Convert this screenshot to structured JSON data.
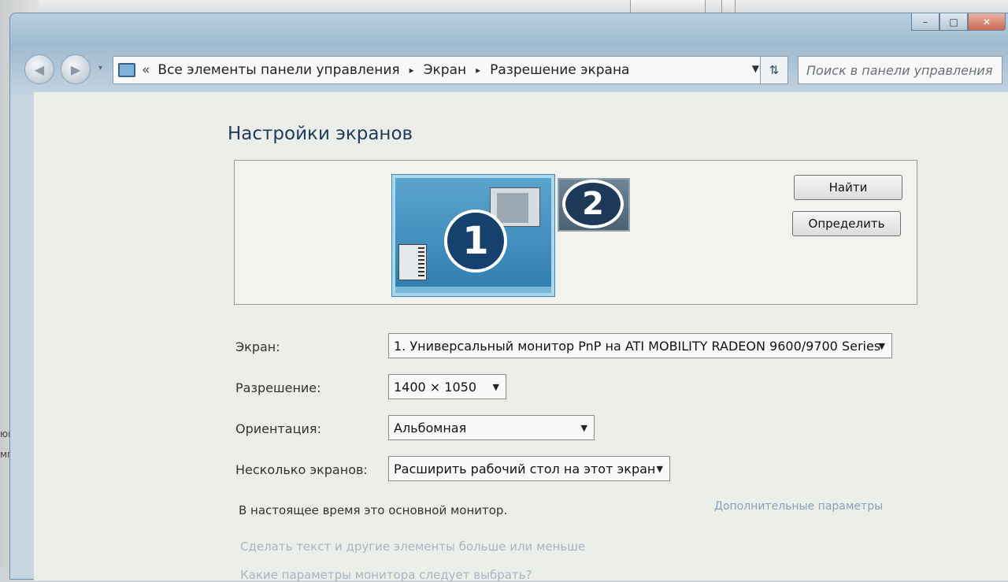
{
  "background": {
    "left_text_1": "юист",
    "left_text_2": "мпн"
  },
  "window": {
    "caption_minimize": "–",
    "caption_maximize": "□",
    "caption_close": "✕"
  },
  "navbar": {
    "back_icon": "◀",
    "forward_icon": "▶",
    "dropdown_icon": "▾",
    "address": {
      "chevrons": "«",
      "crumbs": [
        "Все элементы панели управления",
        "Экран",
        "Разрешение экрана"
      ],
      "separator": "▸",
      "dropdown": "▼"
    },
    "refresh_icon": "⇅",
    "search_placeholder": "Поиск в панели управления"
  },
  "main": {
    "title": "Настройки экранов",
    "monitors": [
      {
        "number": "1"
      },
      {
        "number": "2"
      }
    ],
    "buttons": {
      "find": "Найти",
      "identify": "Определить"
    },
    "fields": {
      "screen_label": "Экран:",
      "screen_value": "1. Универсальный монитор PnP на ATI MOBILITY RADEON 9600/9700 Series",
      "resolution_label": "Разрешение:",
      "resolution_value": "1400 × 1050",
      "orientation_label": "Ориентация:",
      "orientation_value": "Альбомная",
      "multi_label": "Несколько экранов:",
      "multi_value": "Расширить рабочий стол на этот экран"
    },
    "status": "В настоящее время это основной монитор.",
    "advanced_link": "Дополнительные параметры",
    "links": [
      "Сделать текст и другие элементы больше или меньше",
      "Какие параметры монитора следует выбрать?"
    ]
  }
}
